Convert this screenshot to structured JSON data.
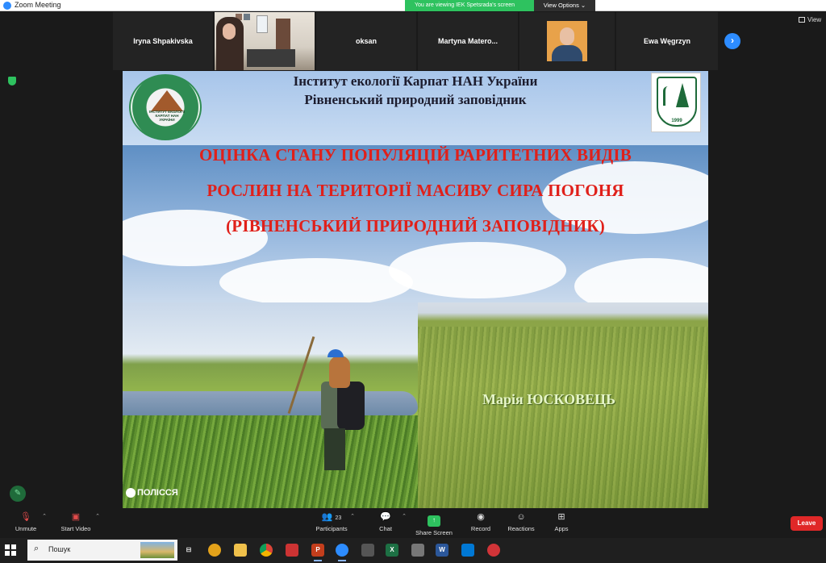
{
  "window": {
    "title": "Zoom Meeting"
  },
  "share_banner": {
    "message": "You are viewing IEK Spetsrada's screen",
    "view_options": "View Options"
  },
  "gallery": {
    "participants": [
      {
        "name": "Iryna Shpakivska"
      },
      {
        "name": ""
      },
      {
        "name": "oksan"
      },
      {
        "name": "Martyna  Matero..."
      },
      {
        "name": ""
      },
      {
        "name": "Ewa Węgrzyn"
      }
    ],
    "view_label": "View"
  },
  "slide": {
    "header_line1": "Інститут екології Карпат НАН України",
    "header_line2": "Рівненський природний заповідник",
    "logo_left_text": "ІНСТИТУТ ЕКОЛОГІЇ КАРПАТ НАН УКРАЇНИ",
    "logo_right_year": "1999",
    "title_line1": "ОЦІНКА СТАНУ ПОПУЛЯЦІЙ РАРИТЕТНИХ ВИДІВ",
    "title_line2": "РОСЛИН НА ТЕРИТОРІЇ МАСИВУ СИРА ПОГОНЯ",
    "title_line3": "(РІВНЕНСЬКИЙ ПРИРОДНИЙ ЗАПОВІДНИК)",
    "author": "Марія ЮСКОВЕЦЬ",
    "watermark": "ПОЛІССЯ"
  },
  "controls": {
    "unmute": "Unmute",
    "start_video": "Start Video",
    "participants": "Participants",
    "participants_count": "23",
    "chat": "Chat",
    "share_screen": "Share Screen",
    "record": "Record",
    "reactions": "Reactions",
    "apps": "Apps",
    "leave": "Leave"
  },
  "taskbar": {
    "search_placeholder": "Пошук"
  },
  "colors": {
    "zoom_blue": "#2d8cff",
    "share_green": "#2ec25f",
    "leave_red": "#e02828",
    "slide_title_red": "#e0201a"
  }
}
